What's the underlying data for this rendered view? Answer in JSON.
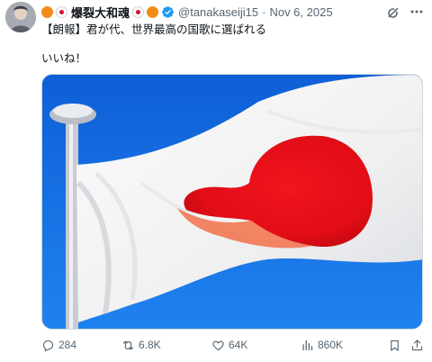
{
  "author": {
    "display_name": "爆裂大和魂",
    "handle": "@tanakaseiji15",
    "separator": "·",
    "date": "Nov 6, 2025",
    "verified": true,
    "name_decorations": [
      "orange-circle",
      "japan-flag-circle",
      "japan-flag-circle",
      "orange-circle"
    ]
  },
  "tweet": {
    "line1": "【朗報】君が代、世界最高の国歌に選ばれる",
    "line2": "いいね！"
  },
  "media": {
    "subject": "japan-flag-on-pole",
    "colors": {
      "sky": "#1a73e8",
      "flag_red": "#e60012",
      "flag_white": "#f7f7f7"
    }
  },
  "actions": {
    "replies": "284",
    "reposts": "6.8K",
    "likes": "64K",
    "views": "860K"
  },
  "colors": {
    "text": "#0f1419",
    "secondary": "#536471",
    "verified": "#1d9bf0"
  }
}
